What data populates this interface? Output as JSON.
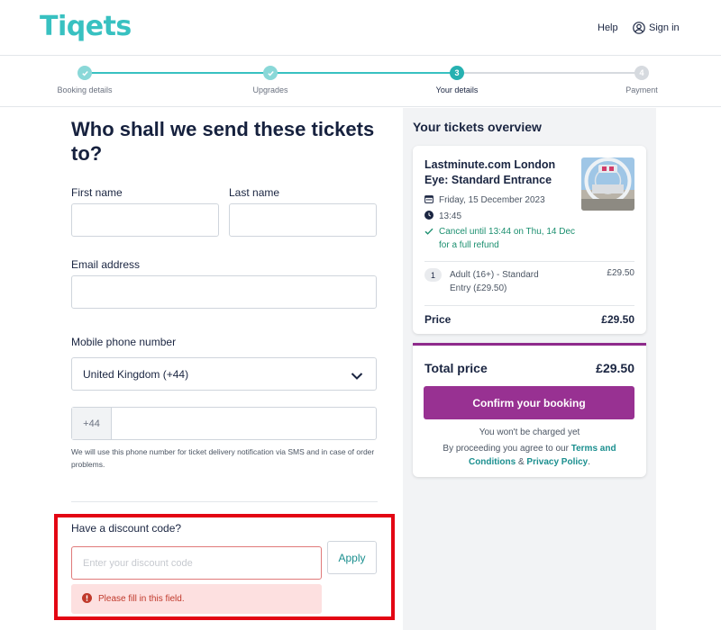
{
  "header": {
    "logo": "Tiqets",
    "help": "Help",
    "sign_in": "Sign in"
  },
  "stepper": {
    "steps": [
      {
        "label": "Booking details",
        "state": "done",
        "number": ""
      },
      {
        "label": "Upgrades",
        "state": "done",
        "number": ""
      },
      {
        "label": "Your details",
        "state": "current",
        "number": "3"
      },
      {
        "label": "Payment",
        "state": "upcoming",
        "number": "4"
      }
    ],
    "accent": "#38c1c1"
  },
  "form": {
    "title": "Who shall we send these tickets to?",
    "first_name_label": "First name",
    "first_name_value": "",
    "last_name_label": "Last name",
    "last_name_value": "",
    "email_label": "Email address",
    "email_value": "",
    "phone_label": "Mobile phone number",
    "country_selected": "United Kingdom (+44)",
    "phone_prefix": "+44",
    "phone_value": "",
    "phone_help": "We will use this phone number for ticket delivery notification via SMS and in case of order problems.",
    "discount_label": "Have a discount code?",
    "discount_placeholder": "Enter your discount code",
    "apply_label": "Apply",
    "error_message": "Please fill in this field."
  },
  "overview": {
    "title": "Your tickets overview",
    "product_title": "Lastminute.com London Eye: Standard Entrance",
    "date": "Friday, 15 December 2023",
    "time": "13:45",
    "cancellation": "Cancel until 13:44 on Thu, 14 Dec for a full refund",
    "quantity": "1",
    "ticket_name": "Adult (16+) - Standard Entry (£29.50)",
    "ticket_price": "£29.50",
    "price_label": "Price",
    "price_value": "£29.50"
  },
  "checkout": {
    "total_label": "Total price",
    "total_value": "£29.50",
    "confirm_label": "Confirm your booking",
    "not_charged": "You won't be charged yet",
    "terms_prefix": "By proceeding you agree to our",
    "terms_link": "Terms and Conditions",
    "terms_and": "&",
    "privacy_link": "Privacy Policy",
    "terms_suffix": ".",
    "brand_color": "#983192"
  },
  "colors": {
    "teal": "#38c1c1",
    "navy": "#16213e",
    "error_red": "#e30613"
  }
}
